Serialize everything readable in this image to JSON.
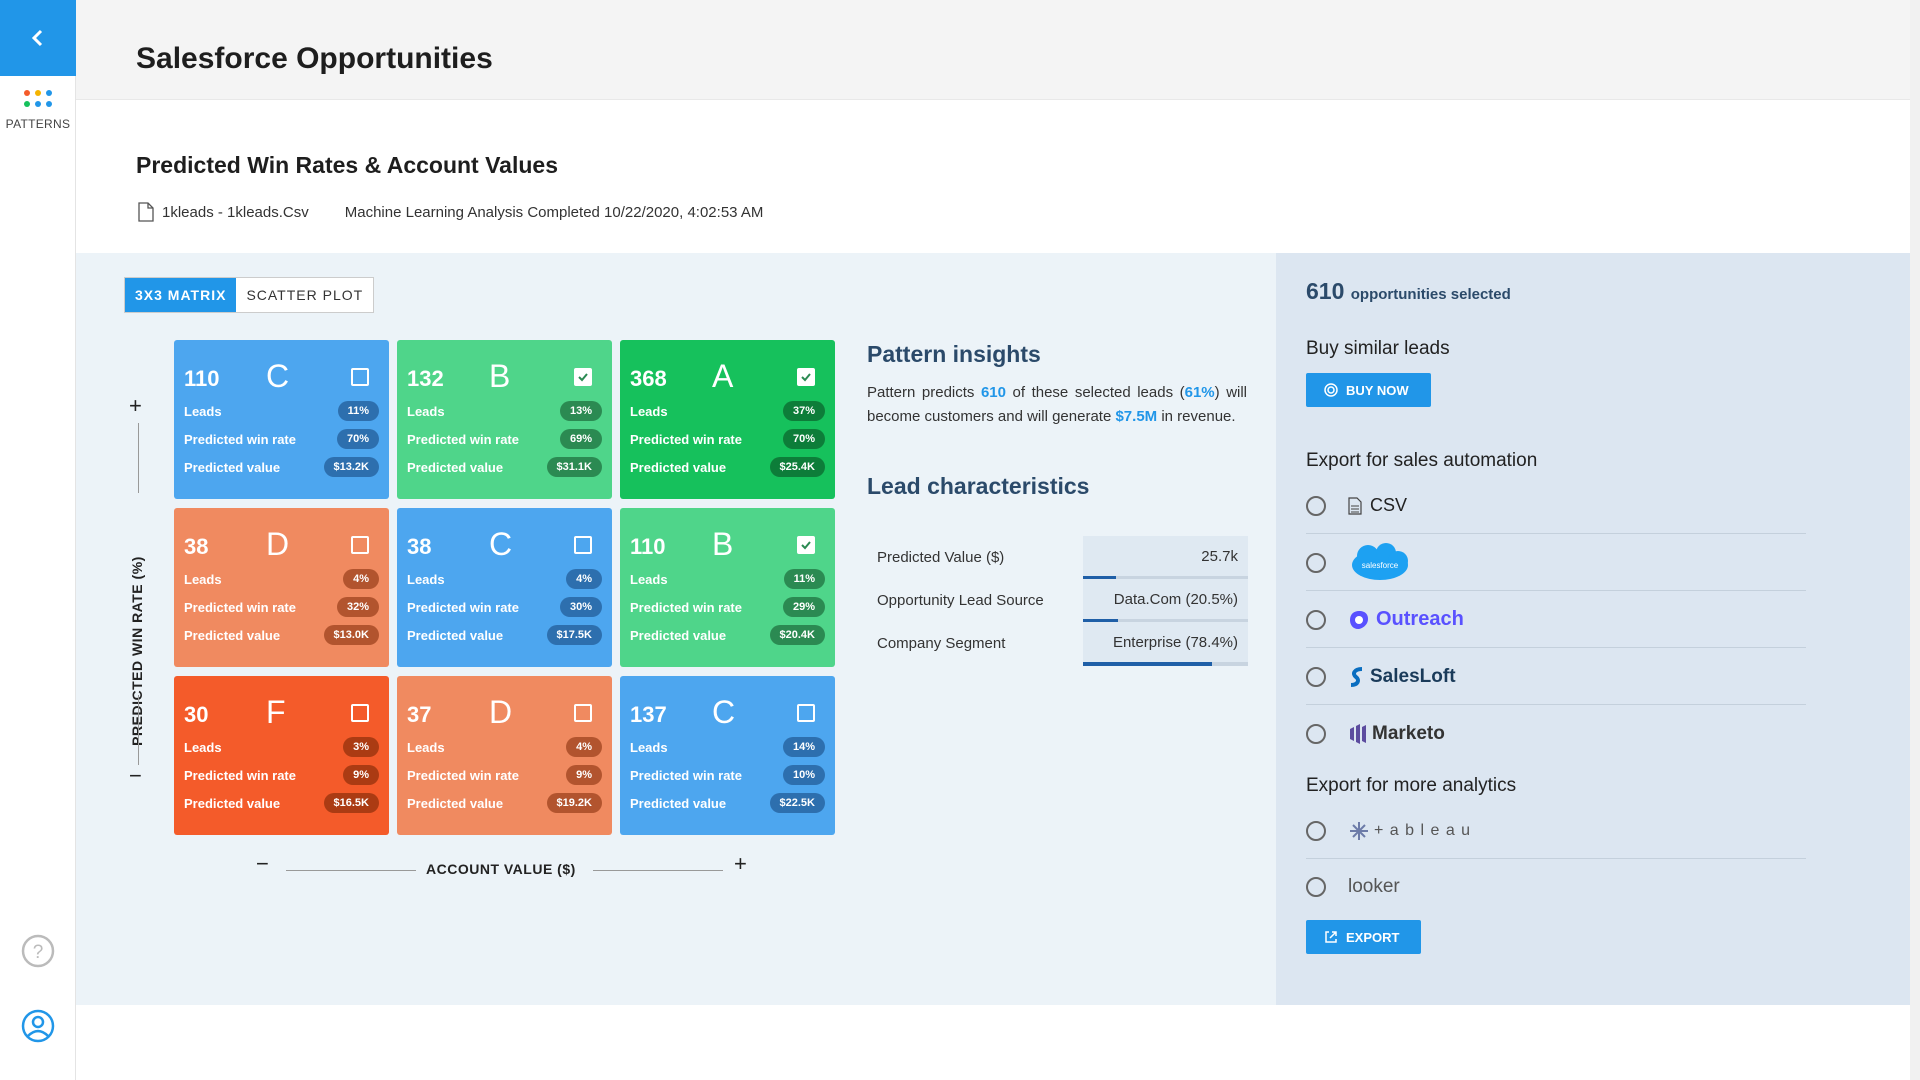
{
  "sidebar": {
    "logo_label": "PATTERNS"
  },
  "header": {
    "title": "Salesforce Opportunities"
  },
  "subhead": "Predicted Win Rates & Account Values",
  "file": {
    "name": "1kleads - 1kleads.Csv",
    "status": "Machine Learning Analysis Completed 10/22/2020, 4:02:53 AM"
  },
  "tabs": [
    {
      "label": "3X3 MATRIX"
    },
    {
      "label": "SCATTER PLOT"
    }
  ],
  "matrix": {
    "row_labels": {
      "leads": "Leads",
      "win": "Predicted win rate",
      "value": "Predicted value"
    },
    "cells": [
      {
        "count": "110",
        "grade": "C",
        "leads": "11%",
        "win": "70%",
        "value": "$13.2K",
        "checked": false,
        "color": "blue"
      },
      {
        "count": "132",
        "grade": "B",
        "leads": "13%",
        "win": "69%",
        "value": "$31.1K",
        "checked": true,
        "color": "green"
      },
      {
        "count": "368",
        "grade": "A",
        "leads": "37%",
        "win": "70%",
        "value": "$25.4K",
        "checked": true,
        "color": "dgreen"
      },
      {
        "count": "38",
        "grade": "D",
        "leads": "4%",
        "win": "32%",
        "value": "$13.0K",
        "checked": false,
        "color": "orange"
      },
      {
        "count": "38",
        "grade": "C",
        "leads": "4%",
        "win": "30%",
        "value": "$17.5K",
        "checked": false,
        "color": "blue"
      },
      {
        "count": "110",
        "grade": "B",
        "leads": "11%",
        "win": "29%",
        "value": "$20.4K",
        "checked": true,
        "color": "green"
      },
      {
        "count": "30",
        "grade": "F",
        "leads": "3%",
        "win": "9%",
        "value": "$16.5K",
        "checked": false,
        "color": "red"
      },
      {
        "count": "37",
        "grade": "D",
        "leads": "4%",
        "win": "9%",
        "value": "$19.2K",
        "checked": false,
        "color": "orange"
      },
      {
        "count": "137",
        "grade": "C",
        "leads": "14%",
        "win": "10%",
        "value": "$22.5K",
        "checked": false,
        "color": "blue"
      }
    ],
    "y_axis": {
      "label": "PREDICTED WIN RATE (%)",
      "plus": "+",
      "minus": "−"
    },
    "x_axis": {
      "label": "ACCOUNT VALUE ($)",
      "plus": "+",
      "minus": "−"
    }
  },
  "insights": {
    "title": "Pattern insights",
    "t1": "Pattern predicts ",
    "n1": "610",
    "t2": " of these selected leads (",
    "n2": "61%",
    "t3": ") will become customers and will generate ",
    "n3": "$7.5M",
    "t4": " in revenue."
  },
  "lead": {
    "title": "Lead characteristics",
    "rows": [
      {
        "label": "Predicted Value ($)",
        "value": "25.7k",
        "fill": 0.2
      },
      {
        "label": "Opportunity Lead Source",
        "value": "Data.Com (20.5%)",
        "fill": 0.205
      },
      {
        "label": "Company Segment",
        "value": "Enterprise (78.4%)",
        "fill": 0.784
      }
    ]
  },
  "right": {
    "count": "610",
    "count_text": "opportunities selected",
    "buy_title": "Buy similar leads",
    "buy_btn": "BUY NOW",
    "export_sales_title": "Export for sales automation",
    "sales_options": [
      "CSV",
      "salesforce",
      "Outreach",
      "SalesLoft",
      "Marketo"
    ],
    "export_analytics_title": "Export for more analytics",
    "analytics_options": [
      "+ a b l e a u",
      "looker"
    ],
    "export_btn": "EXPORT"
  },
  "colors": {
    "accent": "#2196e8",
    "heading": "#2b4a6a"
  }
}
